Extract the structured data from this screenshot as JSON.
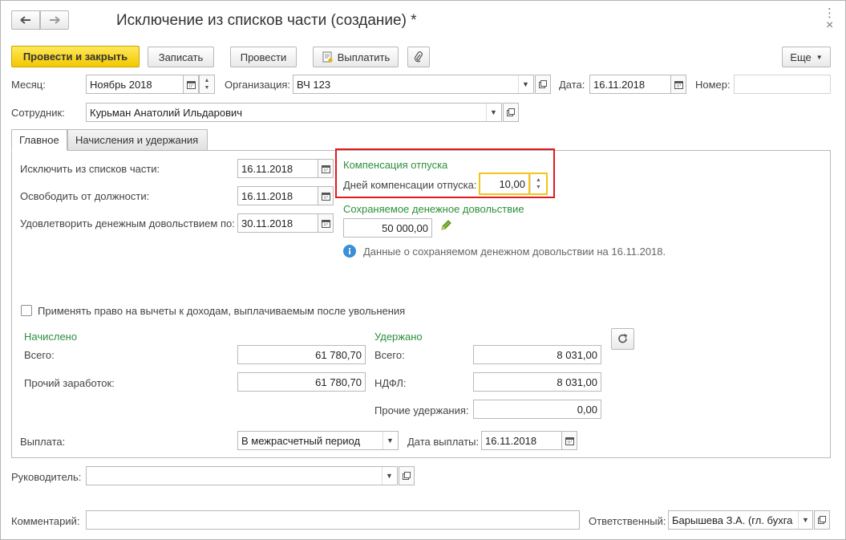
{
  "window": {
    "title": "Исключение из списков части (создание) *",
    "more_label": "⋮",
    "close_label": "×"
  },
  "toolbar": {
    "post_close": "Провести и закрыть",
    "save": "Записать",
    "post": "Провести",
    "pay": "Выплатить",
    "more": "Еще"
  },
  "header": {
    "month_label": "Месяц:",
    "month_value": "Ноябрь 2018",
    "org_label": "Организация:",
    "org_value": "ВЧ 123",
    "date_label": "Дата:",
    "date_value": "16.11.2018",
    "number_label": "Номер:",
    "number_value": "",
    "employee_label": "Сотрудник:",
    "employee_value": "Курьман Анатолий Ильдарович"
  },
  "tabs": [
    {
      "label": "Главное"
    },
    {
      "label": "Начисления и удержания"
    }
  ],
  "main": {
    "exclude_label": "Исключить из списков части:",
    "exclude_value": "16.11.2018",
    "release_label": "Освободить от должности:",
    "release_value": "16.11.2018",
    "allowance_label": "Удовлетворить денежным довольствием по:",
    "allowance_value": "30.11.2018",
    "compensation_title": "Компенсация отпуска",
    "comp_days_label": "Дней компенсации отпуска:",
    "comp_days_value": "10,00",
    "saved_allowance_title": "Сохраняемое денежное довольствие",
    "saved_allowance_value": "50 000,00",
    "info_text": "Данные о сохраняемом денежном довольствии на 16.11.2018.",
    "deduction_checkbox_label": "Применять право на вычеты к доходам, выплачиваемым после увольнения",
    "deduction_checked": false
  },
  "accrued": {
    "title": "Начислено",
    "total_label": "Всего:",
    "total_value": "61 780,70",
    "other_label": "Прочий заработок:",
    "other_value": "61 780,70"
  },
  "withheld": {
    "title": "Удержано",
    "total_label": "Всего:",
    "total_value": "8 031,00",
    "ndfl_label": "НДФЛ:",
    "ndfl_value": "8 031,00",
    "other_label": "Прочие удержания:",
    "other_value": "0,00"
  },
  "payment": {
    "label": "Выплата:",
    "value": "В межрасчетный период",
    "date_label": "Дата выплаты:",
    "date_value": "16.11.2018"
  },
  "footer": {
    "manager_label": "Руководитель:",
    "manager_value": "",
    "comment_label": "Комментарий:",
    "comment_value": "",
    "responsible_label": "Ответственный:",
    "responsible_value": "Барышева З.А. (гл. бухга"
  },
  "colors": {
    "primary_button": "#f2c800",
    "section_title": "#2c8f3d",
    "highlight_box": "#e0191c",
    "focused_field": "#f5c518",
    "info_icon": "#3a8fd6"
  },
  "icons": {
    "back": "arrow-left-icon",
    "forward": "arrow-right-icon",
    "calendar": "calendar-icon",
    "open": "open-in-window-icon",
    "dropdown": "chevron-down-icon",
    "attach": "paperclip-icon",
    "pay": "document-pay-icon",
    "edit": "pencil-icon",
    "info": "info-icon",
    "refresh": "refresh-icon"
  }
}
